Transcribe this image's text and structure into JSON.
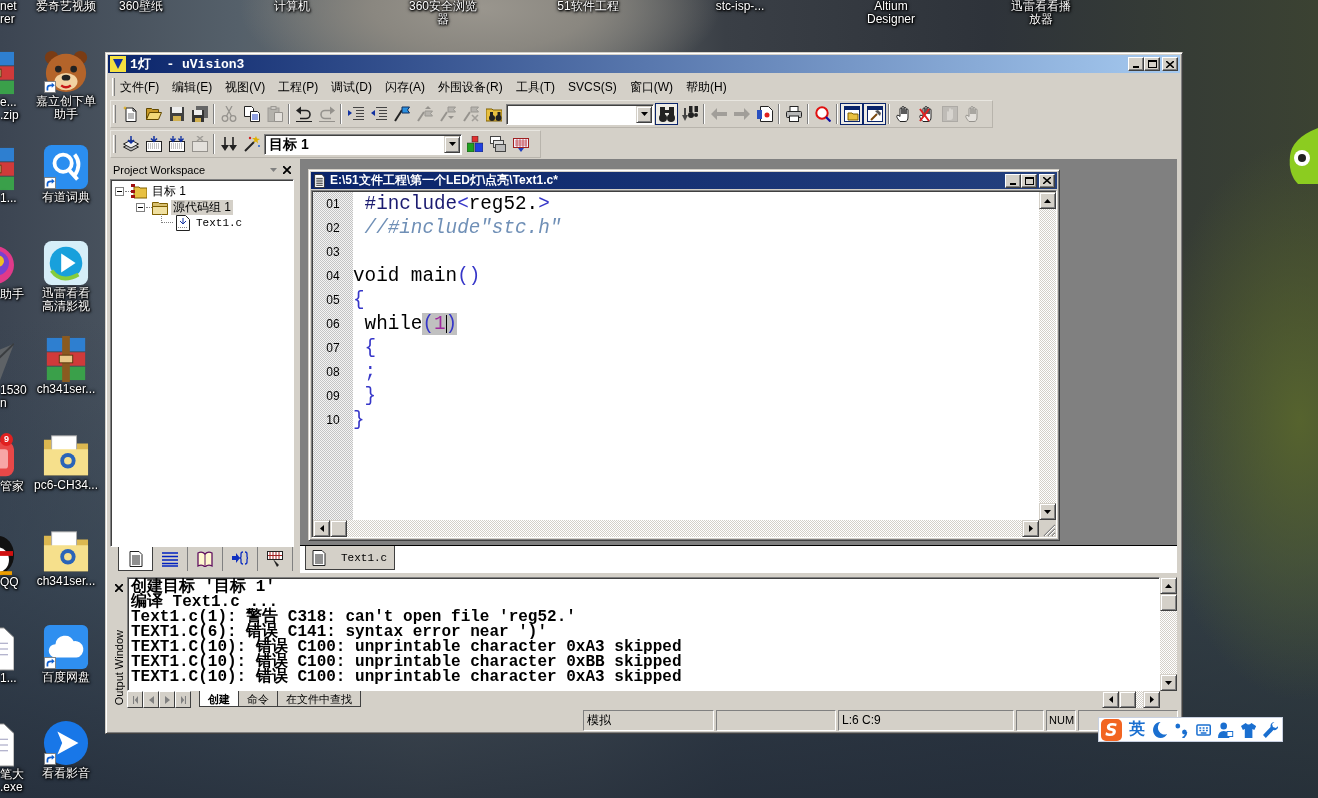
{
  "desktop": {
    "top_labels": [
      "net\nrer",
      "爱奇艺视频",
      "360壁纸",
      "计算机",
      "360安全浏览器",
      "51软件工程",
      "stc-isp-...",
      "Altium\nDesigner",
      "迅雷看看播放器"
    ],
    "edge_icons": [
      {
        "label": "e...\n.zip",
        "kind": "archive"
      },
      {
        "label": "1...",
        "kind": "archive"
      },
      {
        "label": "助手",
        "kind": "swirl"
      },
      {
        "label": "1530\nn",
        "kind": "plane"
      },
      {
        "label": "管家",
        "kind": "tile",
        "badge": "9"
      },
      {
        "label": "QQ",
        "kind": "penguin"
      },
      {
        "label": "1...",
        "kind": "page"
      },
      {
        "label": "笔大\n.exe",
        "kind": "page"
      }
    ],
    "icons": [
      {
        "label": "嘉立创下单助手",
        "kind": "bear",
        "shortcut": true
      },
      {
        "label": "有道词典",
        "kind": "dictionary",
        "shortcut": true
      },
      {
        "label": "迅雷看看高清影视",
        "kind": "player",
        "shortcut": false
      },
      {
        "label": "ch341ser...",
        "kind": "archive",
        "shortcut": false
      },
      {
        "label": "pc6-CH34...",
        "kind": "folder",
        "shortcut": false
      },
      {
        "label": "ch341ser...",
        "kind": "folder",
        "shortcut": false
      },
      {
        "label": "百度网盘",
        "kind": "cloud",
        "shortcut": true
      },
      {
        "label": "看看影音",
        "kind": "play",
        "shortcut": true
      }
    ]
  },
  "window": {
    "title": "1灯  - uVision3",
    "menu": [
      "文件(F)",
      "编辑(E)",
      "视图(V)",
      "工程(P)",
      "调试(D)",
      "闪存(A)",
      "外围设备(R)",
      "工具(T)",
      "SVCS(S)",
      "窗口(W)",
      "帮助(H)"
    ],
    "toolbars": [
      {
        "items": [
          {
            "kind": "button",
            "disabled": false,
            "pressed": false
          },
          {
            "kind": "button",
            "disabled": false,
            "pressed": false
          },
          {
            "kind": "button",
            "disabled": false,
            "pressed": false
          },
          {
            "kind": "button",
            "disabled": false,
            "pressed": false
          },
          {
            "kind": "separator"
          },
          {
            "kind": "button",
            "disabled": true,
            "pressed": false
          },
          {
            "kind": "button",
            "disabled": false,
            "pressed": false
          },
          {
            "kind": "button",
            "disabled": true,
            "pressed": false
          },
          {
            "kind": "separator"
          },
          {
            "kind": "button",
            "disabled": false,
            "pressed": false
          },
          {
            "kind": "button",
            "disabled": true,
            "pressed": false
          },
          {
            "kind": "separator"
          },
          {
            "kind": "button",
            "disabled": false,
            "pressed": false
          },
          {
            "kind": "button",
            "disabled": false,
            "pressed": false
          },
          {
            "kind": "button",
            "disabled": false,
            "pressed": false
          },
          {
            "kind": "button",
            "disabled": true,
            "pressed": false
          },
          {
            "kind": "button",
            "disabled": true,
            "pressed": false
          },
          {
            "kind": "button",
            "disabled": true,
            "pressed": false
          },
          {
            "kind": "button",
            "disabled": false,
            "pressed": false
          },
          {
            "kind": "combo"
          },
          {
            "kind": "button",
            "disabled": false,
            "pressed": true
          },
          {
            "kind": "button",
            "disabled": false,
            "pressed": false
          },
          {
            "kind": "separator"
          },
          {
            "kind": "button",
            "disabled": true,
            "pressed": false
          },
          {
            "kind": "button",
            "disabled": true,
            "pressed": false
          },
          {
            "kind": "button",
            "disabled": false,
            "pressed": false
          },
          {
            "kind": "separator"
          },
          {
            "kind": "button",
            "disabled": false,
            "pressed": false
          },
          {
            "kind": "separator"
          },
          {
            "kind": "button",
            "disabled": false,
            "pressed": false
          },
          {
            "kind": "separator"
          },
          {
            "kind": "button",
            "disabled": false,
            "pressed": true
          },
          {
            "kind": "button",
            "disabled": false,
            "pressed": true
          },
          {
            "kind": "separator"
          },
          {
            "kind": "button",
            "disabled": false,
            "pressed": false
          },
          {
            "kind": "button",
            "disabled": false,
            "pressed": false
          },
          {
            "kind": "button",
            "disabled": true,
            "pressed": false
          },
          {
            "kind": "button",
            "disabled": true,
            "pressed": false
          }
        ]
      },
      {
        "items": [
          {
            "kind": "button",
            "disabled": false,
            "pressed": false
          },
          {
            "kind": "button",
            "disabled": false,
            "pressed": false
          },
          {
            "kind": "button",
            "disabled": false,
            "pressed": false
          },
          {
            "kind": "button",
            "disabled": true,
            "pressed": false
          },
          {
            "kind": "separator"
          },
          {
            "kind": "button",
            "disabled": false,
            "pressed": false
          },
          {
            "kind": "button",
            "disabled": false,
            "pressed": false
          },
          {
            "kind": "combo",
            "value": "目标 1"
          },
          {
            "kind": "button",
            "disabled": false,
            "pressed": false
          },
          {
            "kind": "button",
            "disabled": false,
            "pressed": false
          },
          {
            "kind": "button",
            "disabled": false,
            "pressed": false
          }
        ]
      }
    ],
    "workspace": {
      "title": "Project Workspace",
      "tree": [
        {
          "label": "目标 1",
          "kind": "target",
          "expanded": true,
          "selected": false,
          "children": [
            {
              "label": "源代码组 1",
              "kind": "group",
              "expanded": true,
              "selected": true,
              "children": [
                {
                  "label": "Text1.c",
                  "kind": "file",
                  "selected": false
                }
              ]
            }
          ]
        }
      ],
      "tabs": [
        {
          "selected": true
        },
        {
          "selected": false
        },
        {
          "selected": false
        },
        {
          "selected": false
        },
        {
          "selected": false
        }
      ]
    },
    "editor": {
      "title": "E:\\51文件工程\\第一个LED灯\\点亮\\Text1.c*",
      "lines": [
        {
          "number": "01",
          "tokens": [
            {
              "text": " #include",
              "kind": "directive",
              "highlighted": false,
              "caret": false
            },
            {
              "text": "<",
              "kind": "symbol",
              "highlighted": false,
              "caret": false
            },
            {
              "text": "reg52.",
              "kind": "plain",
              "highlighted": false,
              "caret": false
            },
            {
              "text": ">",
              "kind": "symbol",
              "highlighted": false,
              "caret": false
            }
          ]
        },
        {
          "number": "02",
          "tokens": [
            {
              "text": " //#include\"stc.h\"",
              "kind": "comment",
              "highlighted": false,
              "caret": false
            }
          ]
        },
        {
          "number": "03"
        },
        {
          "number": "04",
          "tokens": [
            {
              "text": "void main",
              "kind": "plain",
              "highlighted": false,
              "caret": false
            },
            {
              "text": "()",
              "kind": "symbol",
              "highlighted": false,
              "caret": false
            }
          ]
        },
        {
          "number": "05",
          "tokens": [
            {
              "text": "{",
              "kind": "symbol",
              "highlighted": false,
              "caret": false
            }
          ]
        },
        {
          "number": "06",
          "tokens": [
            {
              "text": " while",
              "kind": "plain",
              "highlighted": false,
              "caret": false
            },
            {
              "text": "(",
              "kind": "symbol",
              "highlighted": true,
              "caret": false
            },
            {
              "text": "1",
              "kind": "number",
              "highlighted": true,
              "caret": true
            },
            {
              "text": ")",
              "kind": "symbol",
              "highlighted": true,
              "caret": false
            }
          ]
        },
        {
          "number": "07",
          "tokens": [
            {
              "text": " {",
              "kind": "symbol",
              "highlighted": false,
              "caret": false
            }
          ]
        },
        {
          "number": "08",
          "tokens": [
            {
              "text": " ;",
              "kind": "symbol",
              "highlighted": false,
              "caret": false
            }
          ]
        },
        {
          "number": "09",
          "tokens": [
            {
              "text": " }",
              "kind": "symbol",
              "highlighted": false,
              "caret": false
            }
          ]
        },
        {
          "number": "10",
          "tokens": [
            {
              "text": "}",
              "kind": "symbol",
              "highlighted": false,
              "caret": false
            }
          ]
        }
      ]
    },
    "document_tabs": [
      {
        "label": "Text1.c",
        "selected": true
      }
    ],
    "output": {
      "title": "Output Window",
      "lines": [
        "创建目标 '目标 1'",
        "编译 Text1.c ...",
        "Text1.c(1): 警告 C318: can't open file 'reg52.'",
        "TEXT1.C(6): 错误 C141: syntax error near ')'",
        "TEXT1.C(10): 错误 C100: unprintable character 0xA3 skipped",
        "TEXT1.C(10): 错误 C100: unprintable character 0xBB skipped",
        "TEXT1.C(10): 错误 C100: unprintable character 0xA3 skipped"
      ],
      "nav_buttons": [
        {
          "disabled": true
        },
        {
          "disabled": true
        },
        {
          "disabled": true
        },
        {
          "disabled": true
        }
      ],
      "tabs": [
        {
          "label": "创建",
          "selected": true
        },
        {
          "label": "命令",
          "selected": false
        },
        {
          "label": "在文件中查找",
          "selected": false
        }
      ]
    },
    "status_bar": {
      "mode": "模拟",
      "cursor_position": "L:6 C:9",
      "num_lock": "NUM"
    }
  },
  "input_method": {
    "logo": "S",
    "language": "英"
  }
}
